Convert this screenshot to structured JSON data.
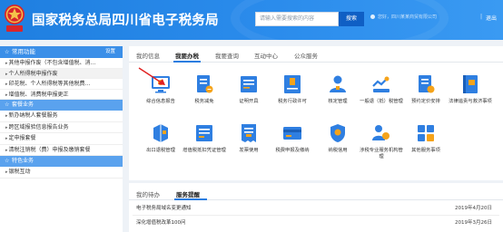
{
  "header": {
    "title": "国家税务总局四川省电子税务局",
    "search_placeholder": "请输入需要搜索的内容",
    "search_button": "搜索",
    "user_text": "您好，四川某某商贸有限公司",
    "separator": "|",
    "logout": "退出"
  },
  "sidebar": {
    "common_title": "常用功能",
    "settings_label": "设置",
    "common_items": [
      "其他申报作废（不包含增值税、消...",
      "个人所得税申报作废",
      "印花税、个人所得税等其他税费...",
      "增值税、消费税申报更正"
    ],
    "categories": [
      {
        "title": "套餐业务",
        "items": [
          "新办纳税人套餐服务",
          "跨区域报验信息报告业务",
          "定申报套餐",
          "清税注销税（费）申报及缴销套餐"
        ]
      },
      {
        "title": "特色业务",
        "items": [
          "银税互动"
        ]
      }
    ]
  },
  "main": {
    "tabs": [
      "我的信息",
      "我要办税",
      "我要查询",
      "互动中心",
      "公众服务"
    ],
    "active_tab": 1,
    "services": [
      {
        "label": "综合信息报告",
        "icon": "monitor-icon"
      },
      {
        "label": "税务减免",
        "icon": "document-icon"
      },
      {
        "label": "证明开具",
        "icon": "certificate-icon"
      },
      {
        "label": "税务行政许可",
        "icon": "license-icon"
      },
      {
        "label": "核定管理",
        "icon": "person-icon"
      },
      {
        "label": "一般退（抵）税管理",
        "icon": "refund-icon"
      },
      {
        "label": "预约定价安排",
        "icon": "schedule-icon"
      },
      {
        "label": "法律追责与救济事项",
        "icon": "law-book-icon"
      },
      {
        "label": "出口退税管理",
        "icon": "export-icon"
      },
      {
        "label": "增值税抵扣凭证管理",
        "icon": "deduction-icon"
      },
      {
        "label": "发票使用",
        "icon": "invoice-icon"
      },
      {
        "label": "税费申报及缴纳",
        "icon": "tax-declare-icon"
      },
      {
        "label": "纳税信用",
        "icon": "credit-icon"
      },
      {
        "label": "涉税专业服务机构管理",
        "icon": "agency-icon"
      },
      {
        "label": "其他服务事项",
        "icon": "other-services-icon"
      }
    ]
  },
  "news": {
    "tabs": [
      "我的待办",
      "服务提醒"
    ],
    "active_tab": 1,
    "rows": [
      {
        "title": "电子税务局域名变更通知",
        "date": "2019年4月20日"
      },
      {
        "title": "深化增值税改革100问",
        "date": "2019年3月26日"
      }
    ]
  },
  "colors": {
    "brand_blue": "#2b7de0",
    "header_blue": "#1f7fe0",
    "icon_blue": "#2f7fe1",
    "icon_orange": "#f5a31a",
    "annotation_red": "#e02020"
  }
}
